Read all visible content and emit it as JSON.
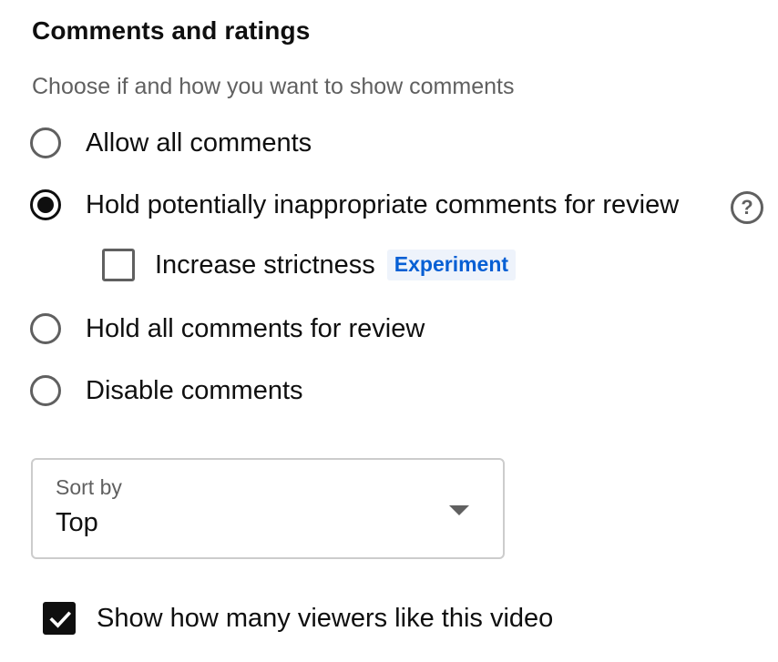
{
  "section": {
    "title": "Comments and ratings",
    "subtitle": "Choose if and how you want to show comments"
  },
  "comment_options": [
    {
      "label": "Allow all comments",
      "selected": false
    },
    {
      "label": "Hold potentially inappropriate comments for review",
      "selected": true
    },
    {
      "label": "Hold all comments for review",
      "selected": false
    },
    {
      "label": "Disable comments",
      "selected": false
    }
  ],
  "help": {
    "icon": "help-circle-icon",
    "glyph": "?"
  },
  "strictness": {
    "label": "Increase strictness",
    "checked": false,
    "badge": "Experiment"
  },
  "sort": {
    "label": "Sort by",
    "value": "Top",
    "icon": "dropdown-caret-icon"
  },
  "likes": {
    "label": "Show how many viewers like this video",
    "checked": true
  },
  "colors": {
    "text_primary": "#0f0f0f",
    "text_secondary": "#606060",
    "accent_blue": "#065fd4",
    "badge_bg": "#eef3fb",
    "border": "#cccccc"
  }
}
